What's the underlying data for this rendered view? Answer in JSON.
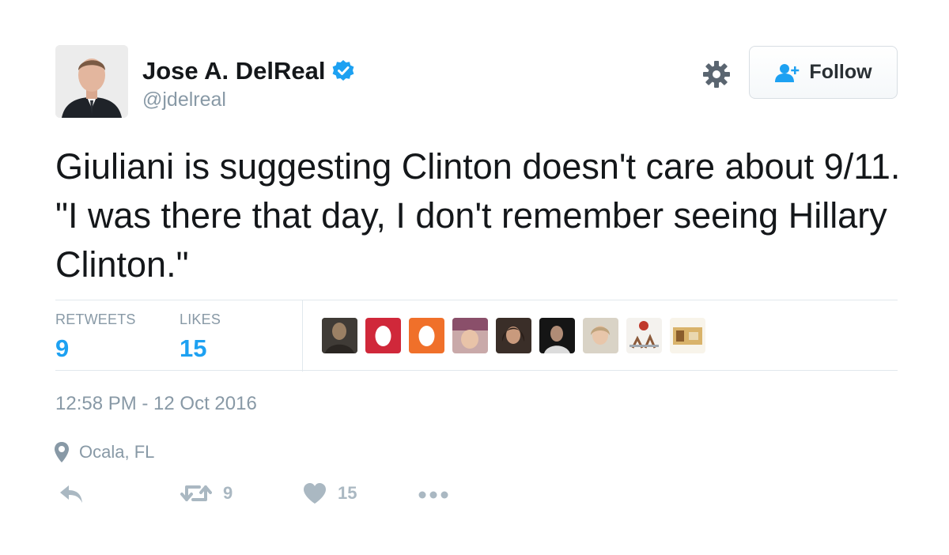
{
  "author": {
    "name": "Jose A. DelReal",
    "handle": "@jdelreal",
    "verified": true
  },
  "follow_button": {
    "label": "Follow"
  },
  "tweet": {
    "text": "Giuliani is suggesting Clinton doesn't care about 9/11. \"I was there that day, I don't remember seeing Hillary Clinton.\"",
    "timestamp": "12:58 PM - 12 Oct 2016",
    "location": "Ocala, FL"
  },
  "stats": {
    "retweets_label": "RETWEETS",
    "retweets_value": "9",
    "likes_label": "LIKES",
    "likes_value": "15"
  },
  "actions": {
    "retweet_count": "9",
    "like_count": "15"
  },
  "colors": {
    "accent": "#1da1f2",
    "muted": "#8899a6",
    "icon": "#aab8c2"
  },
  "icons": [
    "verified-badge-icon",
    "gear-icon",
    "follow-user-icon",
    "location-pin-icon",
    "reply-icon",
    "retweet-icon",
    "heart-icon",
    "more-icon"
  ]
}
